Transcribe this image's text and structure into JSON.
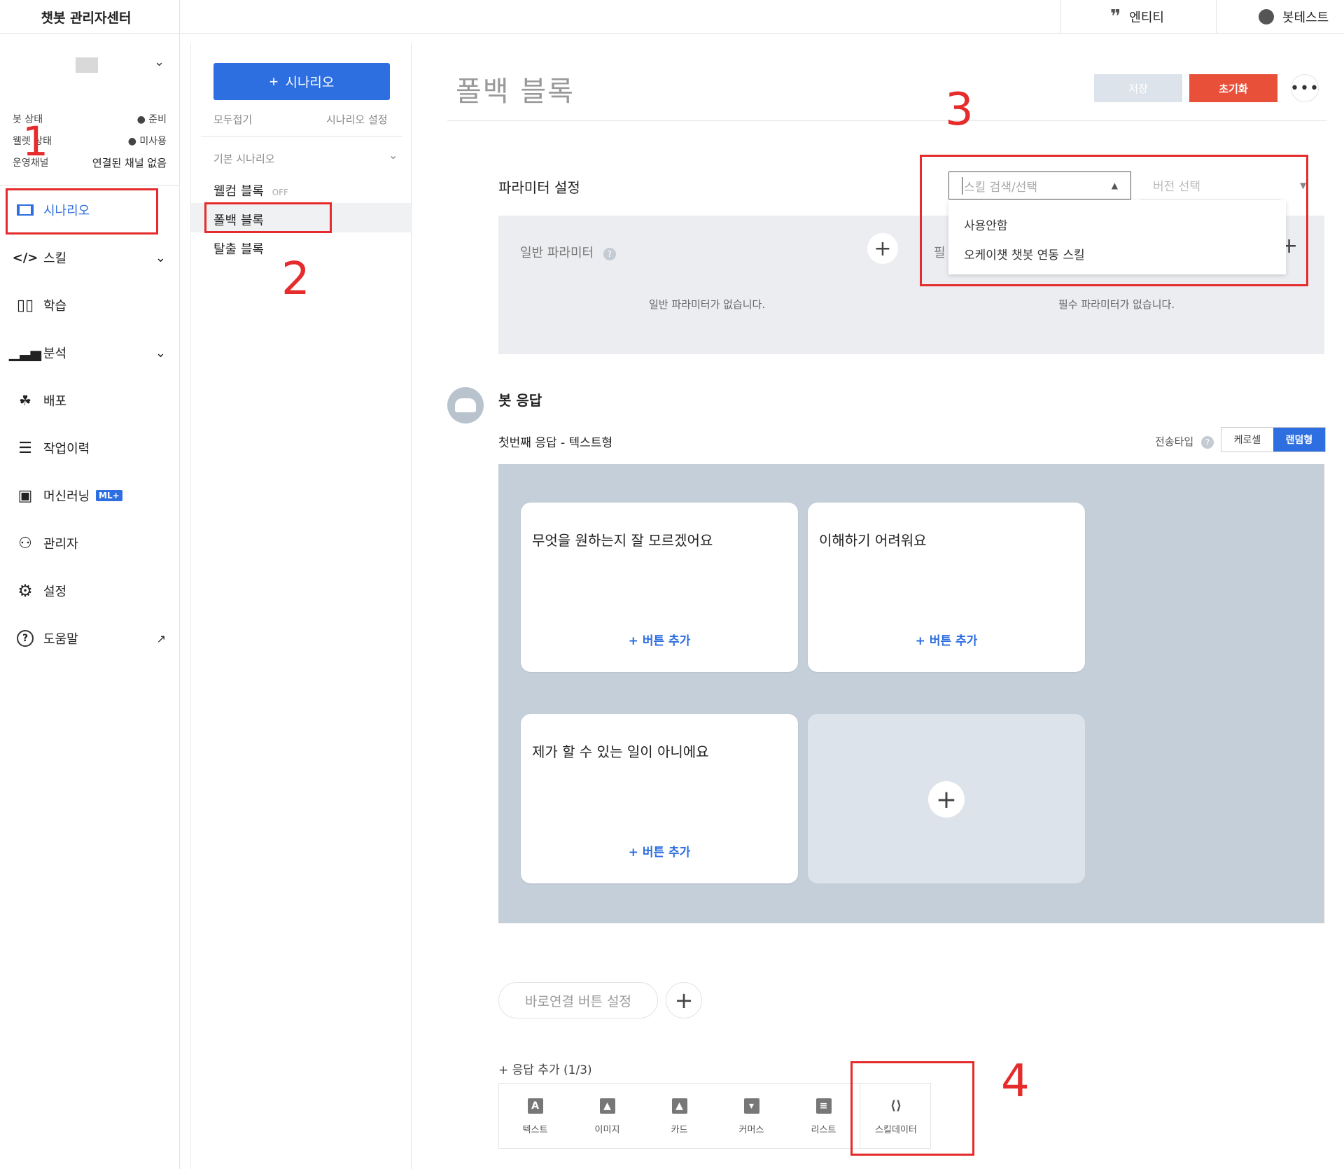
{
  "topbar": {
    "brand": "챗봇 관리자센터",
    "entity_label": "엔티티",
    "bottest_label": "봇테스트"
  },
  "leftnav": {
    "status": [
      {
        "label": "봇 상태",
        "value": "● 준비"
      },
      {
        "label": "웰렛 상태",
        "value": "● 미사용"
      },
      {
        "label": "운영채널",
        "value": "연결된 채널 없음"
      }
    ],
    "items": [
      {
        "label": "시나리오"
      },
      {
        "label": "스킬"
      },
      {
        "label": "학습"
      },
      {
        "label": "분석"
      },
      {
        "label": "배포"
      },
      {
        "label": "작업이력"
      },
      {
        "label": "머신러닝",
        "badge": "ML+"
      },
      {
        "label": "관리자"
      },
      {
        "label": "설정"
      },
      {
        "label": "도움말"
      }
    ]
  },
  "scenario_panel": {
    "add_button": "시나리오",
    "collapse_all": "모두접기",
    "scenario_settings": "시나리오 설정",
    "group_label": "기본 시나리오",
    "items": [
      {
        "label": "웰컴 블록",
        "tag": "OFF"
      },
      {
        "label": "폴백 블록"
      },
      {
        "label": "탈출 블록"
      }
    ]
  },
  "main": {
    "title": "폴백 블록",
    "save_label": "저장",
    "reset_label": "초기화",
    "param_section_title": "파라미터 설정",
    "skill_placeholder": "스킬 검색/선택",
    "version_placeholder": "버전 선택",
    "skill_options": [
      "사용안함",
      "오케이챗 챗봇 연동 스킬"
    ],
    "general_param_label": "일반 파라미터",
    "required_param_label_partial": "필",
    "general_param_empty": "일반 파라미터가 없습니다.",
    "required_param_empty": "필수 파라미터가 없습니다.",
    "bot_response_title": "봇 응답",
    "first_response_label": "첫번째 응답 - 텍스트형",
    "send_type_label": "전송타입",
    "send_type_options": [
      "케로셀",
      "랜덤형"
    ],
    "cards": [
      {
        "text": "무엇을 원하는지 잘 모르겠어요",
        "add_button": "+ 버튼 추가"
      },
      {
        "text": "이해하기 어려워요",
        "add_button": "+ 버튼 추가"
      },
      {
        "text": "제가 할 수 있는 일이 아니에요",
        "add_button": "+ 버튼 추가"
      }
    ],
    "quick_reply_label": "바로연결 버튼 설정",
    "add_response_label": "+ 응답 추가 (1/3)",
    "response_types": [
      {
        "label": "텍스트",
        "icon": "text-type-icon",
        "glyph": "A"
      },
      {
        "label": "이미지",
        "icon": "image-type-icon",
        "glyph": "▲"
      },
      {
        "label": "카드",
        "icon": "card-type-icon",
        "glyph": "▲"
      },
      {
        "label": "커머스",
        "icon": "commerce-type-icon",
        "glyph": "▾"
      },
      {
        "label": "리스트",
        "icon": "list-type-icon",
        "glyph": "≡"
      },
      {
        "label": "스킬데이터",
        "icon": "skill-data-icon",
        "glyph": "⟨⟩"
      }
    ]
  },
  "annotations": [
    "1",
    "2",
    "3",
    "4"
  ],
  "colors": {
    "accent": "#2d6ee0",
    "reset": "#e8503a",
    "annotation": "#e52b2b",
    "response_bg": "#c5cfd9"
  }
}
